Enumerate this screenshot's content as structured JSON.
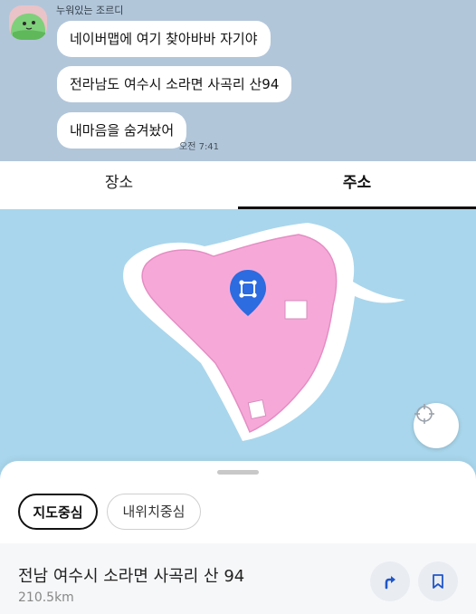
{
  "chat": {
    "sender_name": "누워있는 조르디",
    "messages": [
      "네이버맵에 여기 찾아바바 자기야",
      "전라남도 여수시 소라면 사곡리 산94",
      "내마음을 숨겨놨어"
    ],
    "time": "오전 7:41"
  },
  "tabs": [
    {
      "label": "장소",
      "active": false
    },
    {
      "label": "주소",
      "active": true
    }
  ],
  "map": {
    "water_color": "#a9d6ec",
    "land_color": "#f6a9d9",
    "marker_color": "#2c6be0",
    "marker_icon": "location-pin-icon",
    "locate_icon": "crosshair-icon"
  },
  "sheet": {
    "chips": [
      "지도중심",
      "내위치중심"
    ],
    "address": "전남 여수시 소라면 사곡리 산 94",
    "distance": "210.5km",
    "route_icon": "turn-arrow-icon",
    "save_icon": "bookmark-icon"
  }
}
